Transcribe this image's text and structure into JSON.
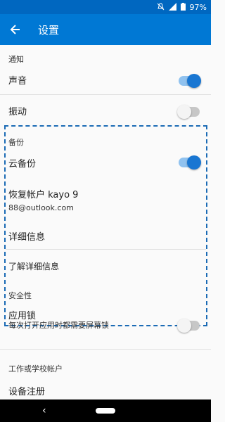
{
  "status_bar": {
    "mute_icon": "bell-off-icon",
    "signal_icon": "signal-icon",
    "battery_icon": "battery-icon",
    "battery": "97%"
  },
  "app_bar": {
    "back_icon": "arrow-left-icon",
    "title": "设置"
  },
  "notifications": {
    "header": "通知",
    "sound": {
      "label": "声音",
      "on": true
    },
    "vibrate": {
      "label": "振动",
      "on": false
    }
  },
  "backup": {
    "header": "备份",
    "cloud_backup": {
      "label": "云备份",
      "on": true
    },
    "recovery_account": {
      "title": "恢复帐户 kayo 9",
      "email": "88@outlook.com"
    },
    "details": "详细信息",
    "learn_more": "了解详细信息"
  },
  "security": {
    "header": "安全性",
    "app_lock": {
      "label": "应用锁",
      "description": "每次打开应用时都需要屏幕锁",
      "on": false
    }
  },
  "work_account": {
    "header": "工作或学校帐户",
    "device_registration": "设备注册"
  },
  "nav_bar": {
    "back_symbol": "‹"
  },
  "colors": {
    "primary": "#0078d4",
    "status_bar": "#0067c0",
    "toggle_on": "#1976d2",
    "dashed_border": "#1b6bb5"
  }
}
